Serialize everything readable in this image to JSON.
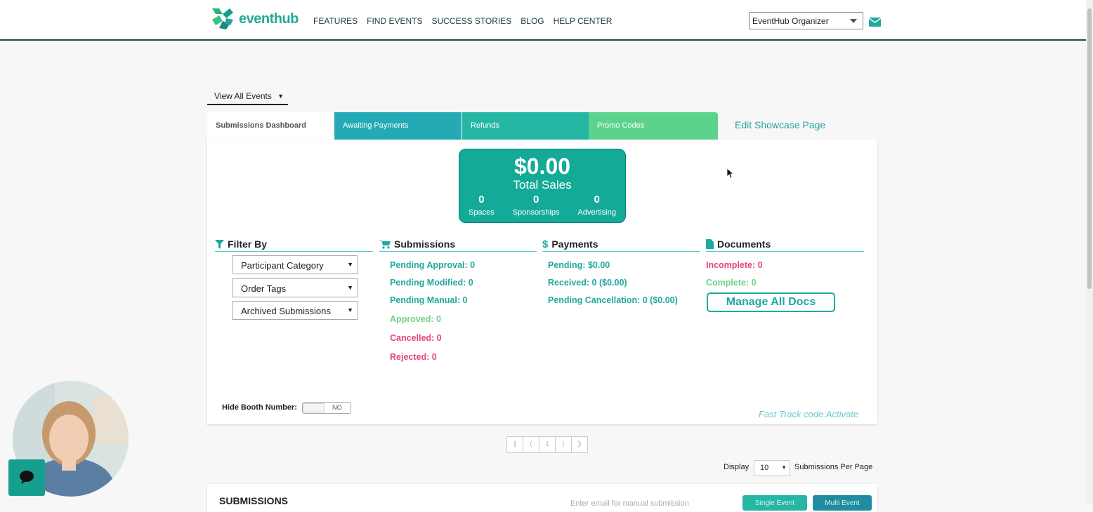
{
  "brand": {
    "name": "eventhub"
  },
  "nav": [
    "FEATURES",
    "FIND EVENTS",
    "SUCCESS STORIES",
    "BLOG",
    "HELP CENTER"
  ],
  "org_select": {
    "value": "EventHub Organizer"
  },
  "view_all": "View All Events",
  "tabs": [
    {
      "label": "Submissions Dashboard"
    },
    {
      "label": "Awaiting Payments"
    },
    {
      "label": "Refunds"
    },
    {
      "label": "Promo Codes"
    }
  ],
  "edit_showcase": "Edit Showcase Page",
  "sales": {
    "amount": "$0.00",
    "label": "Total Sales",
    "stats": [
      {
        "value": "0",
        "label": "Spaces"
      },
      {
        "value": "0",
        "label": "Sponsorships"
      },
      {
        "value": "0",
        "label": "Advertising"
      }
    ]
  },
  "filter": {
    "title": "Filter By",
    "selects": [
      "Participant Category",
      "Order Tags",
      "Archived Submissions"
    ]
  },
  "submissions": {
    "title": "Submissions",
    "rows": [
      "Pending Approval: 0",
      "Pending Modified: 0",
      "Pending Manual: 0",
      "Approved: 0",
      "Cancelled: 0",
      "Rejected: 0"
    ]
  },
  "payments": {
    "title": "Payments",
    "rows": [
      "Pending: $0.00",
      "Received: 0 ($0.00)",
      "Pending Cancellation: 0 ($0.00)"
    ]
  },
  "documents": {
    "title": "Documents",
    "rows": [
      "Incomplete: 0",
      "Complete: 0"
    ],
    "manage": "Manage All Docs"
  },
  "hide_booth": {
    "label": "Hide Booth Number:",
    "toggle": "NO"
  },
  "fast_track": "Fast Track code:Activate",
  "pager": [
    "⟪",
    "⟨",
    "1",
    "⟩",
    "⟫"
  ],
  "display": {
    "label": "Display",
    "value": "10",
    "suffix": "Submissions Per Page"
  },
  "bottom": {
    "title": "SUBMISSIONS",
    "email_placeholder": "Enter email for manual submission",
    "single": "Single Event",
    "multi": "Multi Event"
  },
  "colors": {
    "teal": "#20a8a0",
    "green": "#6fd28a",
    "pink": "#e5447a",
    "tab_blue": "#24aab5"
  }
}
